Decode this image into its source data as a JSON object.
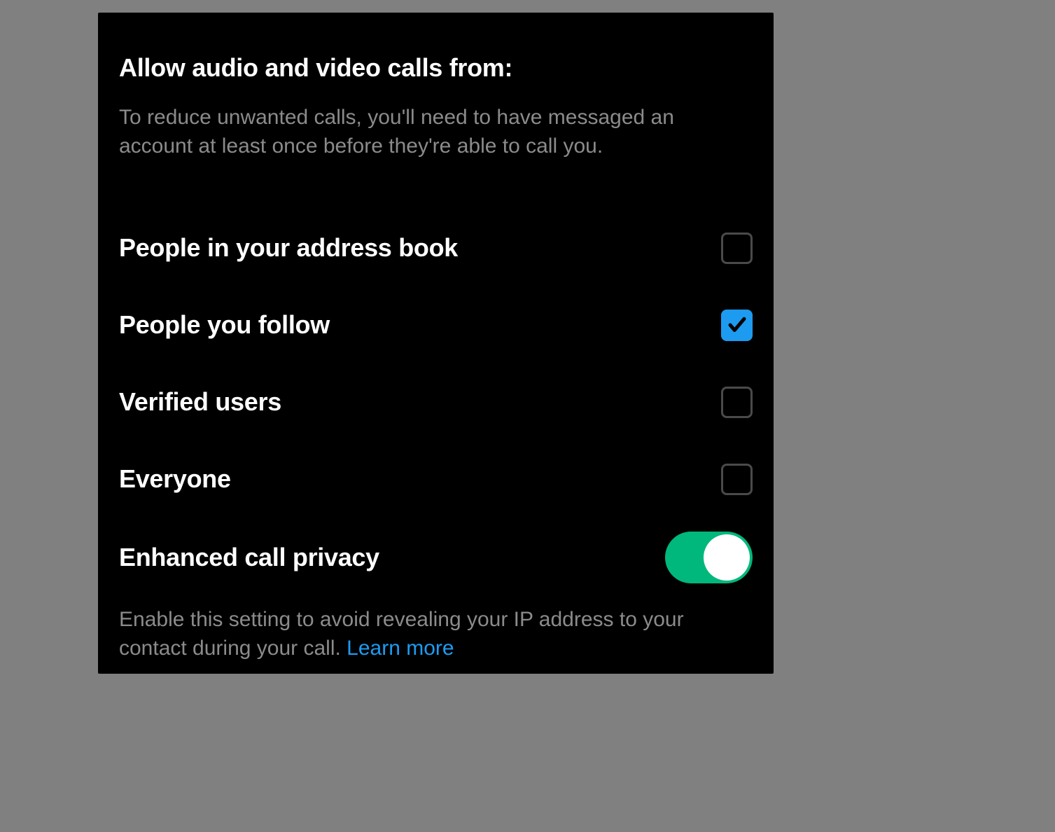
{
  "colors": {
    "accent": "#1d9bf0",
    "toggle_on": "#00b87c",
    "panel_bg": "#000000",
    "page_bg": "#808080",
    "text_primary": "#ffffff",
    "text_secondary": "#8b8b8b"
  },
  "section": {
    "title": "Allow audio and video calls from:",
    "description": "To reduce unwanted calls, you'll need to have messaged an account at least once before they're able to call you."
  },
  "options": [
    {
      "label": "People in your address book",
      "checked": false
    },
    {
      "label": "People you follow",
      "checked": true
    },
    {
      "label": "Verified users",
      "checked": false
    },
    {
      "label": "Everyone",
      "checked": false
    }
  ],
  "privacy": {
    "label": "Enhanced call privacy",
    "enabled": true,
    "description": "Enable this setting to avoid revealing your IP address to your contact during your call. ",
    "learn_more": "Learn more"
  }
}
